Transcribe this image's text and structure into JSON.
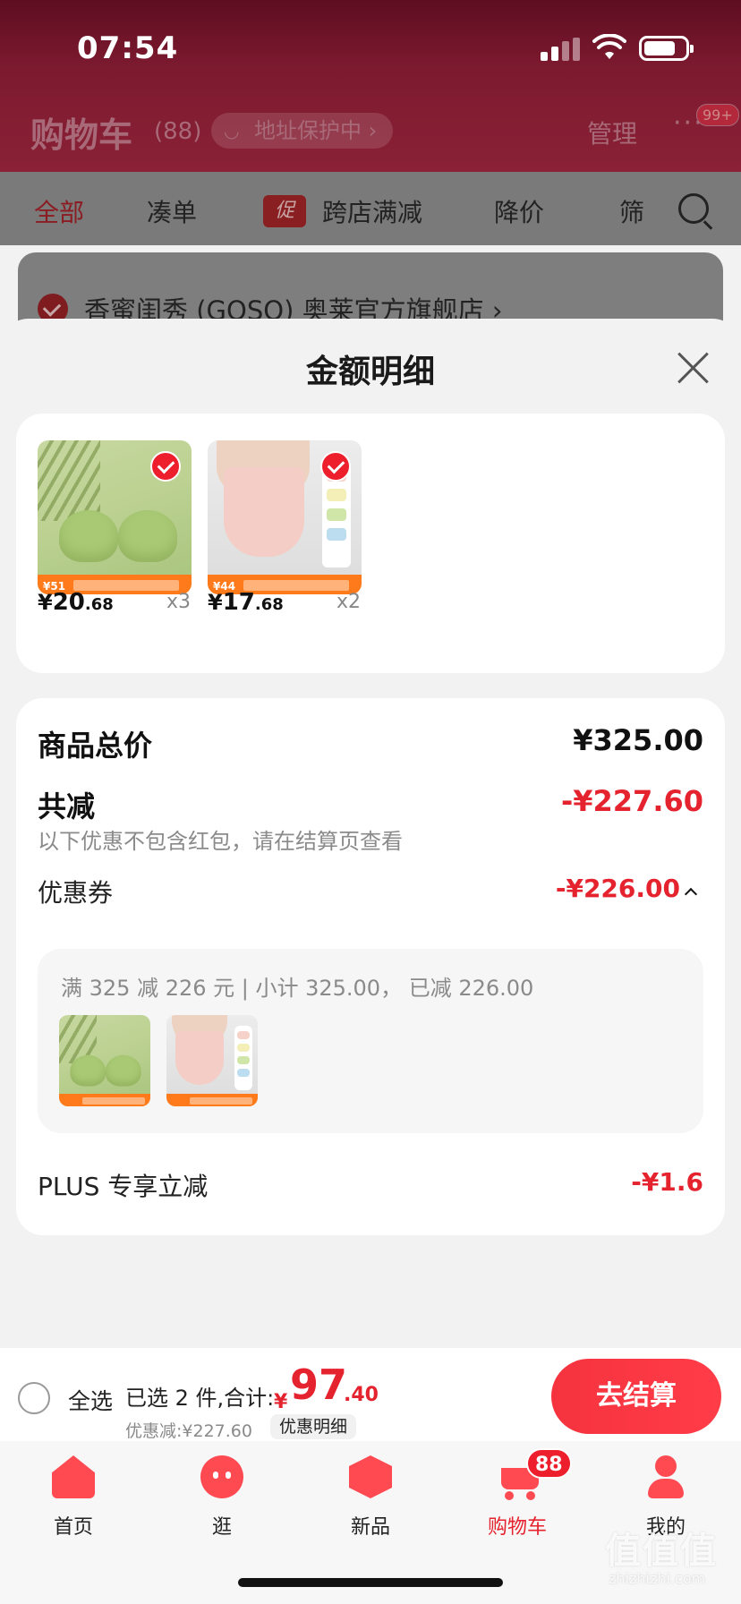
{
  "status_bar": {
    "time": "07:54"
  },
  "cart_header": {
    "title": "购物车",
    "count": "(88)",
    "address_pill": "地址保护中 ›",
    "manage": "管理",
    "more": "···",
    "badge": "99+"
  },
  "filter_tabs": {
    "all": "全部",
    "bundle": "凑单",
    "promo_tag": "促",
    "cross_store": "跨店满减",
    "price_drop": "降价",
    "filter": "筛"
  },
  "store": {
    "name": "香蜜闺秀 (GOSO) 奥莱官方旗舰店 ›"
  },
  "sheet": {
    "title": "金额明细",
    "products": [
      {
        "thumb_tag": "¥51",
        "yen": "¥",
        "price_int": "20",
        "price_dec": ".68",
        "qty": "x3",
        "selected": true
      },
      {
        "thumb_tag": "¥44",
        "yen": "¥",
        "price_int": "17",
        "price_dec": ".68",
        "qty": "x2",
        "selected": true
      }
    ],
    "summary": {
      "goods_total_label": "商品总价",
      "goods_total_value": "¥325.00",
      "total_reduce_label": "共减",
      "total_reduce_value": "-¥227.60",
      "note": "以下优惠不包含红包，请在结算页查看",
      "coupon_label": "优惠券",
      "coupon_value": "-¥226.00",
      "coupon_desc": "满 325 减 226 元 | 小计 325.00， 已减 226.00",
      "plus_label": "PLUS 专享立减",
      "plus_value": "-¥1.6"
    }
  },
  "checkout": {
    "select_all": "全选",
    "selected_info": "已选 2 件,合计:",
    "total_yen": "¥",
    "total_int": "97",
    "total_dec": ".40",
    "discount": "优惠减:¥227.60",
    "detail": "优惠明细",
    "checkout_button": "去结算"
  },
  "tabbar": {
    "items": [
      {
        "label": "首页"
      },
      {
        "label": "逛"
      },
      {
        "label": "新品"
      },
      {
        "label": "购物车",
        "badge": "88"
      },
      {
        "label": "我的"
      }
    ]
  },
  "watermark": {
    "main": "值值值",
    "sub": "zhizhizhi.com"
  },
  "colors": {
    "accent_red": "#e5232f",
    "header_maroon": "#7d1a30",
    "orange_banner": "#ff7a1a"
  }
}
